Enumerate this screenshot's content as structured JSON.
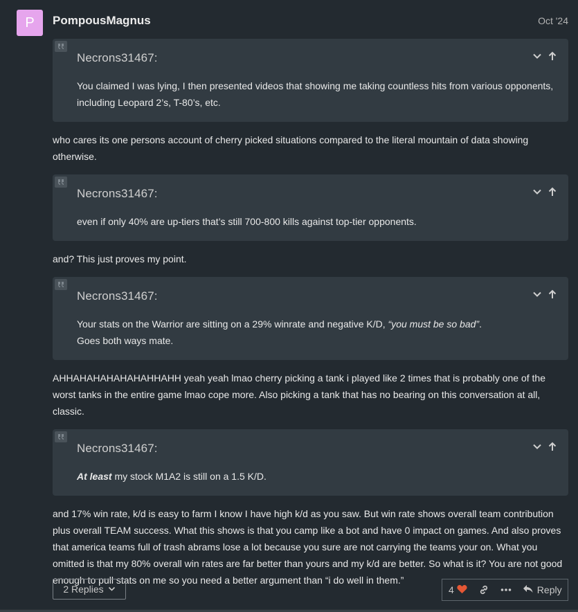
{
  "post": {
    "avatar_letter": "P",
    "avatar_color": "#e6a5ed",
    "username": "PompousMagnus",
    "date": "Oct '24"
  },
  "blocks": {
    "q1": {
      "author": "Necrons31467:",
      "text": "You claimed I was lying, I then presented videos that showing me taking countless hits from various opponents, including Leopard 2’s, T-80’s, etc."
    },
    "p1": "who cares its one persons account of cherry picked situations compared to the literal mountain of data showing otherwise.",
    "q2": {
      "author": "Necrons31467:",
      "text": "even if only 40% are up-tiers that’s still 700-800 kills against top-tier opponents."
    },
    "p2": "and? This just proves my point.",
    "q3": {
      "author": "Necrons31467:",
      "text_before": "Your stats on the Warrior are sitting on a 29% winrate and negative K/D, ",
      "text_italic": "“you must be so bad”",
      "text_after": ".",
      "text_line2": "Goes both ways mate."
    },
    "p3": "AHHAHAHAHAHAHAHHAHH yeah yeah lmao cherry picking a tank i played like 2 times that is probably one of the worst tanks in the entire game lmao cope more. Also picking a tank that has no bearing on this conversation at all, classic.",
    "q4": {
      "author": "Necrons31467:",
      "text_bold_italic": "At least",
      "text_rest": " my stock M1A2 is still on a 1.5 K/D."
    },
    "p4": "and 17% win rate, k/d is easy to farm I know I have high k/d as you saw. But win rate shows overall team contribution plus overall TEAM success. What this shows is that you camp like a bot and have 0 impact on games. And also proves that america teams full of trash abrams lose a lot because you sure are not carrying the teams your on. What you omitted is that my 80% overall win rates are far better than yours and my k/d are better. So what is it? You are not good enough to pull stats on me so you need a better argument than “i do well in them.”"
  },
  "footer": {
    "replies_label": "2 Replies",
    "like_count": "4",
    "reply_label": "Reply",
    "heart_color": "#e45735"
  }
}
